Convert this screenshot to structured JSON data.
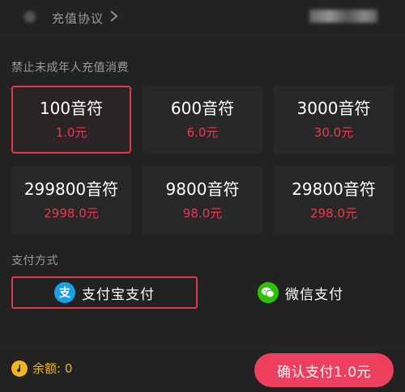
{
  "header": {
    "agreement_label": "充值协议"
  },
  "warning": "禁止未成年人充值消费",
  "packages": [
    {
      "amount": "100音符",
      "price": "1.0元"
    },
    {
      "amount": "600音符",
      "price": "6.0元"
    },
    {
      "amount": "3000音符",
      "price": "30.0元"
    },
    {
      "amount": "299800音符",
      "price": "2998.0元"
    },
    {
      "amount": "9800音符",
      "price": "98.0元"
    },
    {
      "amount": "29800音符",
      "price": "298.0元"
    }
  ],
  "payment": {
    "label": "支付方式",
    "methods": [
      {
        "label": "支付宝支付",
        "icon": "alipay-icon",
        "icon_char": "支",
        "color": "#1aa0e8"
      },
      {
        "label": "微信支付",
        "icon": "wechat-icon",
        "color": "#2dc100"
      }
    ]
  },
  "footer": {
    "balance": "余额: 0",
    "confirm_label": "确认支付1.0元"
  },
  "colors": {
    "accent": "#ed3f5e",
    "price": "#ea3a50",
    "balance": "#f2b51e",
    "background": "#222222"
  }
}
